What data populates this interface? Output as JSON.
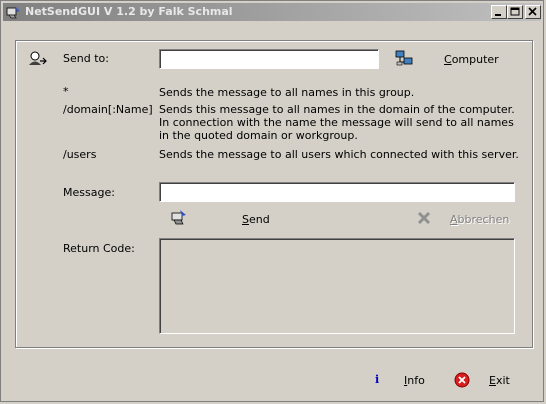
{
  "window": {
    "title": "NetSendGUI V 1.2 by Falk Schmal"
  },
  "send_to": {
    "label": "Send to:",
    "value": "",
    "computer_button": "Computer",
    "computer_button_accel": "C",
    "computer_button_rest": "omputer"
  },
  "targets": [
    {
      "key": "*",
      "description": "Sends the message to all names in this group."
    },
    {
      "key": "/domain[:Name]",
      "description": "Sends this message to all names in the domain of the computer. In connection with the name the message will send to all names in the quoted domain or workgroup."
    },
    {
      "key": "/users",
      "description": "Sends the message to all users which connected with this server."
    }
  ],
  "message": {
    "label": "Message:",
    "value": ""
  },
  "actions": {
    "send_accel": "S",
    "send_rest": "end",
    "cancel_accel": "A",
    "cancel_rest": "bbrechen"
  },
  "return_code": {
    "label": "Return Code:",
    "value": ""
  },
  "footer": {
    "info_accel": "I",
    "info_rest": "nfo",
    "exit_accel": "E",
    "exit_rest": "xit"
  },
  "colors": {
    "exit_icon": "#d81e1e",
    "info_icon": "#0000c0",
    "titlebar_start": "#808080",
    "titlebar_end": "#c0c0c0"
  }
}
